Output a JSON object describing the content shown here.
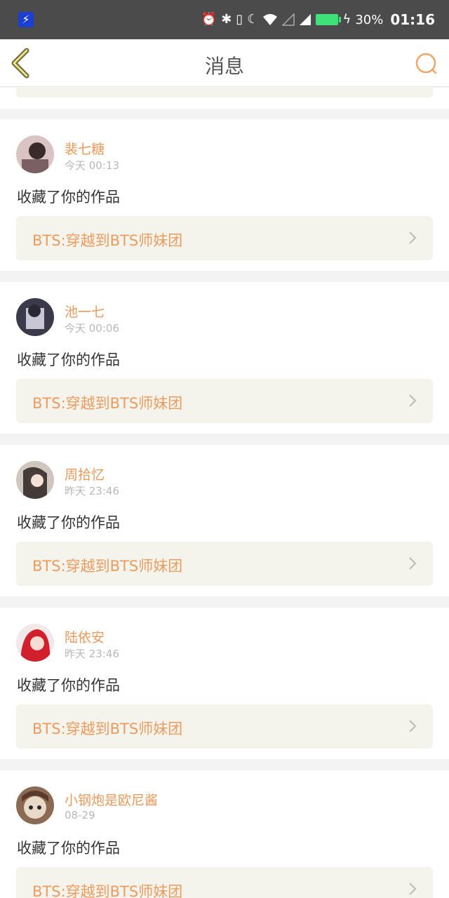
{
  "status_bar": {
    "battery_percent": "30%",
    "time": "01:16",
    "icons": [
      "flash-icon",
      "alarm-icon",
      "bluetooth-icon",
      "vibrate-icon",
      "moon-icon",
      "wifi-icon",
      "signal-icon",
      "battery-icon"
    ]
  },
  "nav": {
    "title": "消息",
    "back_icon": "back-chevron-icon",
    "search_icon": "search-icon",
    "accent_color": "#e89a5d"
  },
  "messages": [
    {
      "name": "裴七糖",
      "time": "今天 00:13",
      "action": "收藏了你的作品",
      "work": "BTS:穿越到BTS师妹团"
    },
    {
      "name": "池一七",
      "time": "今天 00:06",
      "action": "收藏了你的作品",
      "work": "BTS:穿越到BTS师妹团"
    },
    {
      "name": "周拾忆",
      "time": "昨天 23:46",
      "action": "收藏了你的作品",
      "work": "BTS:穿越到BTS师妹团"
    },
    {
      "name": "陆依安",
      "time": "昨天 23:46",
      "action": "收藏了你的作品",
      "work": "BTS:穿越到BTS师妹团"
    },
    {
      "name": "小钢炮是欧尼酱",
      "time": "08-29",
      "action": "收藏了你的作品",
      "work": "BTS:穿越到BTS师妹团"
    }
  ]
}
